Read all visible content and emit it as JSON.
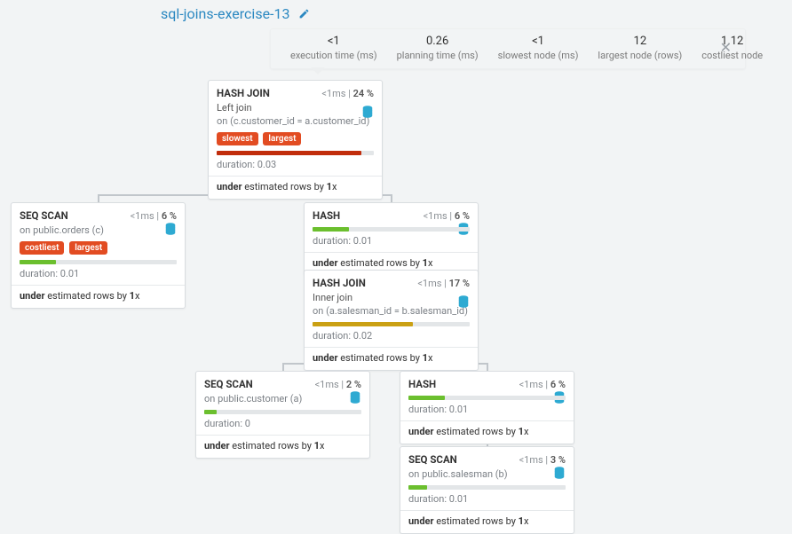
{
  "title": "sql-joins-exercise-13",
  "summary": {
    "exec_time": {
      "value": "<1",
      "label": "execution time (ms)"
    },
    "plan_time": {
      "value": "0.26",
      "label": "planning time (ms)"
    },
    "slowest": {
      "value": "<1",
      "label": "slowest node (ms)"
    },
    "largest": {
      "value": "12",
      "label": "largest node (rows)"
    },
    "costliest": {
      "value": "1.12",
      "label": "costliest node"
    }
  },
  "nodes": {
    "hash_join_1": {
      "name": "HASH JOIN",
      "ms": "<1ms",
      "pct": "24 %",
      "detail1": "Left join",
      "detail2": "on (c.customer_id = a.customer_id)",
      "tags": [
        "slowest",
        "largest"
      ],
      "bar_color": "red",
      "bar_width": "92%",
      "duration": "duration: 0.03",
      "est_pre": "under",
      "est_mid": " estimated rows by ",
      "est_b": "1",
      "est_post": "x"
    },
    "seq_scan_orders": {
      "name": "SEQ SCAN",
      "ms": "<1ms",
      "pct": "6 %",
      "detail1": "on public.orders (c)",
      "tags": [
        "costliest",
        "largest"
      ],
      "bar_color": "green",
      "bar_width": "23%",
      "duration": "duration: 0.01",
      "est_pre": "under",
      "est_mid": " estimated rows by ",
      "est_b": "1",
      "est_post": "x"
    },
    "hash_1": {
      "name": "HASH",
      "ms": "<1ms",
      "pct": "6 %",
      "bar_color": "green",
      "bar_width": "23%",
      "duration": "duration: 0.01",
      "est_pre": "under",
      "est_mid": " estimated rows by ",
      "est_b": "1",
      "est_post": "x"
    },
    "hash_join_2": {
      "name": "HASH JOIN",
      "ms": "<1ms",
      "pct": "17 %",
      "detail1": "Inner join",
      "detail2": "on (a.salesman_id = b.salesman_id)",
      "bar_color": "orange",
      "bar_width": "64%",
      "duration": "duration: 0.02",
      "est_pre": "under",
      "est_mid": " estimated rows by ",
      "est_b": "1",
      "est_post": "x"
    },
    "seq_scan_customer": {
      "name": "SEQ SCAN",
      "ms": "<1ms",
      "pct": "2 %",
      "detail1": "on public.customer (a)",
      "bar_color": "green",
      "bar_width": "8%",
      "duration": "duration: 0",
      "est_pre": "under",
      "est_mid": " estimated rows by ",
      "est_b": "1",
      "est_post": "x"
    },
    "hash_2": {
      "name": "HASH",
      "ms": "<1ms",
      "pct": "6 %",
      "bar_color": "green",
      "bar_width": "23%",
      "duration": "duration: 0.01",
      "est_pre": "under",
      "est_mid": " estimated rows by ",
      "est_b": "1",
      "est_post": "x"
    },
    "seq_scan_salesman": {
      "name": "SEQ SCAN",
      "ms": "<1ms",
      "pct": "3 %",
      "detail1": "on public.salesman (b)",
      "bar_color": "green",
      "bar_width": "12%",
      "duration": "duration: 0.01",
      "est_pre": "under",
      "est_mid": " estimated rows by ",
      "est_b": "1",
      "est_post": "x"
    }
  }
}
